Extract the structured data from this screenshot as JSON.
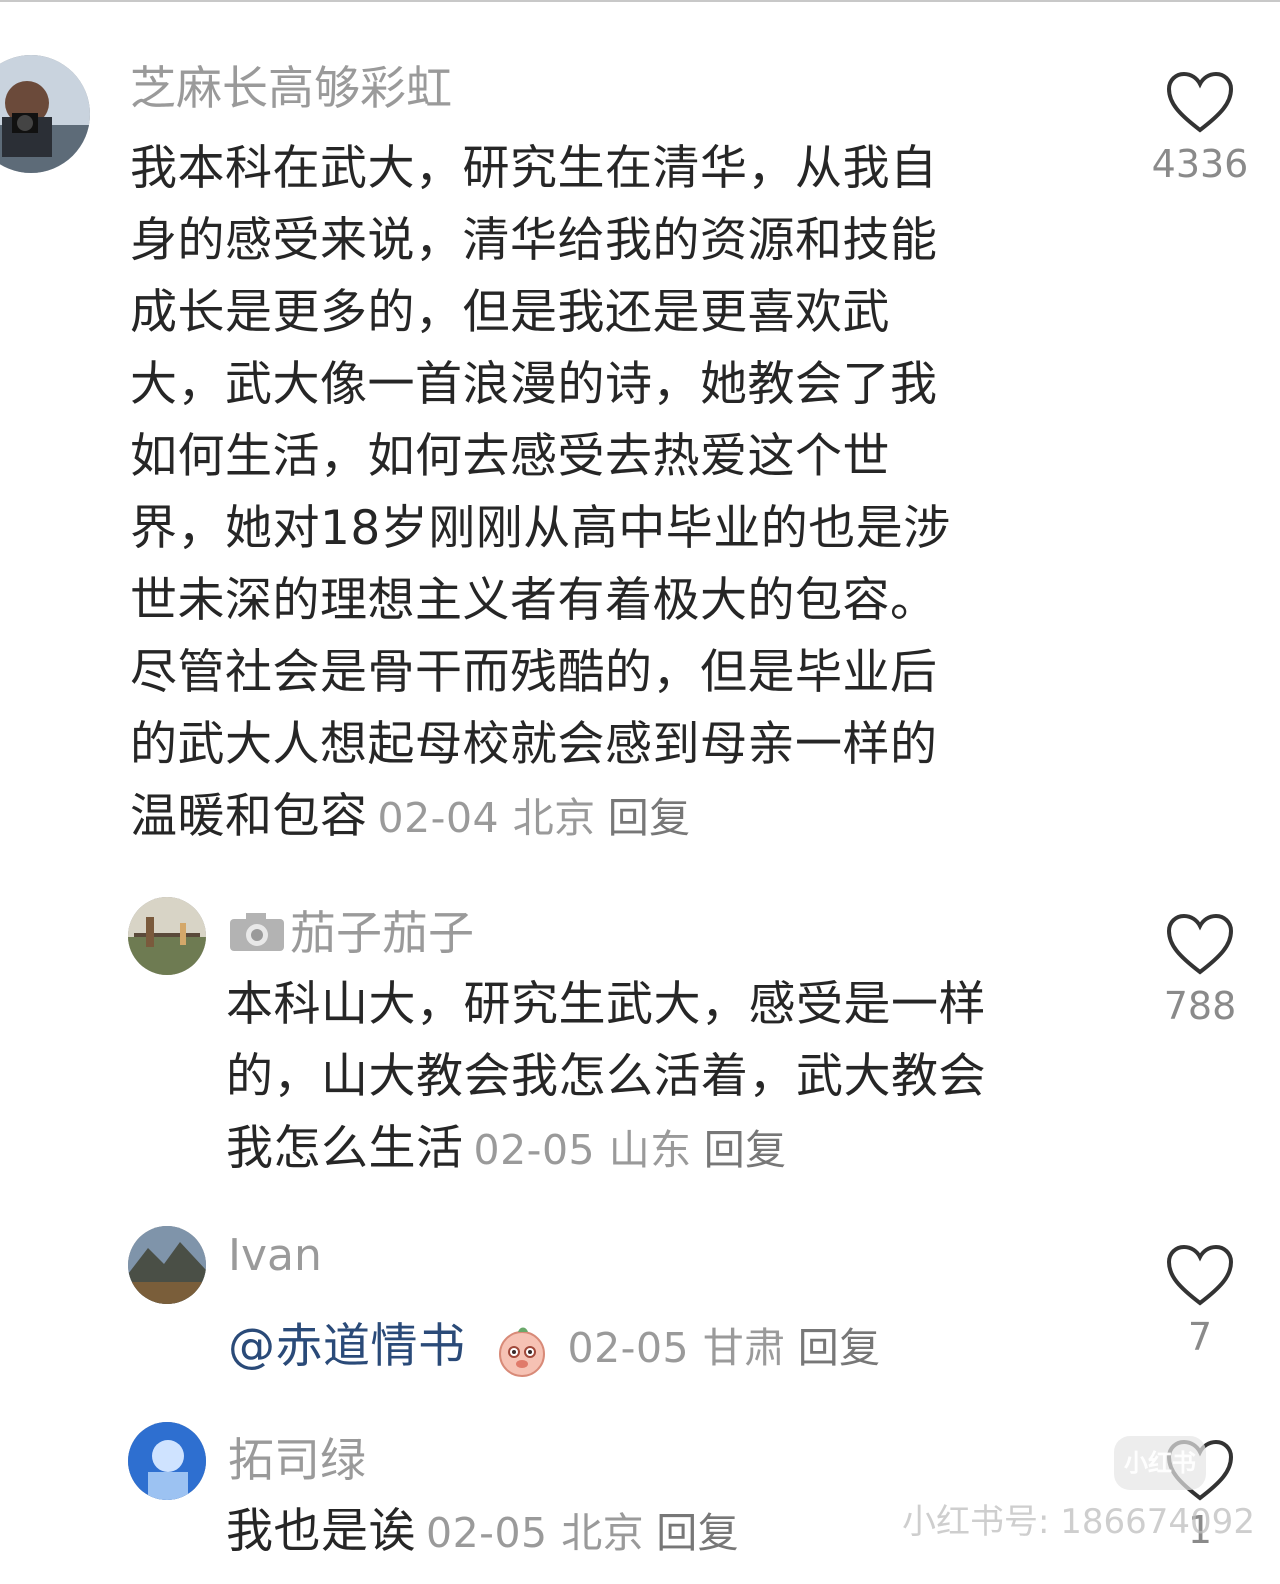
{
  "comments": [
    {
      "username": "芝麻长高够彩虹",
      "lines": [
        "我本科在武大，研究生在清华，从我自",
        "身的感受来说，清华给我的资源和技能",
        "成长是更多的，但是我还是更喜欢武",
        "大，武大像一首浪漫的诗，她教会了我",
        "如何生活，如何去感受去热爱这个世",
        "界，她对18岁刚刚从高中毕业的也是涉",
        "世未深的理想主义者有着极大的包容。",
        "尽管社会是骨干而残酷的，但是毕业后",
        "的武大人想起母校就会感到母亲一样的",
        "温暖和包容"
      ],
      "date": "02-04",
      "location": "北京",
      "reply": "回复",
      "likes": "4336"
    },
    {
      "username": "茄子茄子",
      "lines": [
        "本科山大，研究生武大，感受是一样",
        "的，山大教会我怎么活着，武大教会",
        "我怎么生活"
      ],
      "date": "02-05",
      "location": "山东",
      "reply": "回复",
      "likes": "788"
    },
    {
      "username": "Ivan",
      "mention": "@赤道情书",
      "date": "02-05",
      "location": "甘肃",
      "reply": "回复",
      "likes": "7"
    },
    {
      "username": "拓司绿",
      "text": "我也是诶",
      "date": "02-05",
      "location": "北京",
      "reply": "回复",
      "likes": "1"
    }
  ],
  "watermark": {
    "logo_text": "小红书",
    "text": "小红书号: 186674092"
  }
}
